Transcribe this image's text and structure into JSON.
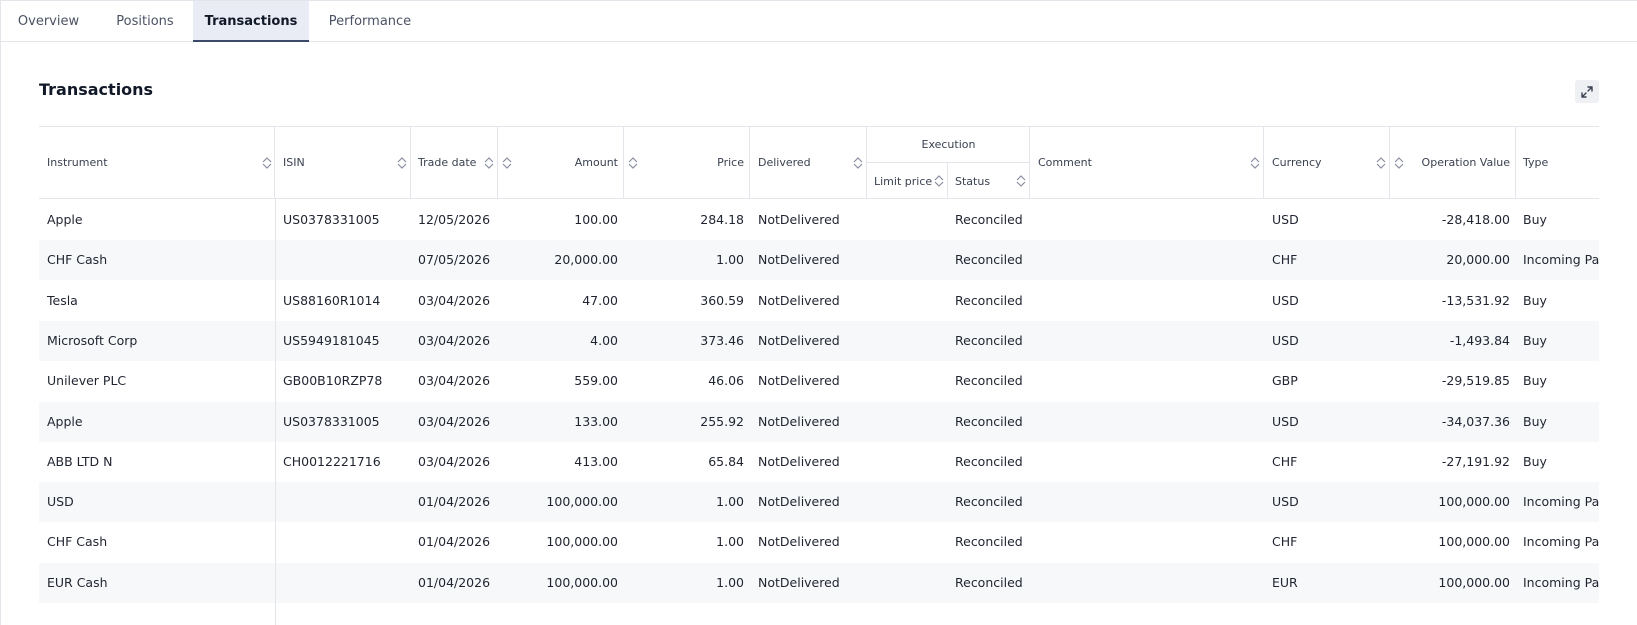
{
  "tabs": [
    {
      "label": "Overview"
    },
    {
      "label": "Positions"
    },
    {
      "label": "Transactions"
    },
    {
      "label": "Performance"
    }
  ],
  "panel": {
    "title": "Transactions"
  },
  "table": {
    "headers": {
      "instrument": "Instrument",
      "isin": "ISIN",
      "trade_date": "Trade date",
      "amount": "Amount",
      "price": "Price",
      "delivered": "Delivered",
      "execution": "Execution",
      "limit_price": "Limit price",
      "status": "Status",
      "comment": "Comment",
      "currency": "Currency",
      "operation_value": "Operation Value",
      "type": "Type"
    },
    "rows": [
      {
        "instrument": "Apple",
        "isin": "US0378331005",
        "trade_date": "12/05/2026",
        "amount": "100.00",
        "price": "284.18",
        "delivered": "NotDelivered",
        "limit_price": "",
        "status": "Reconciled",
        "comment": "",
        "currency": "USD",
        "operation_value": "-28,418.00",
        "type": "Buy"
      },
      {
        "instrument": "CHF Cash",
        "isin": "",
        "trade_date": "07/05/2026",
        "amount": "20,000.00",
        "price": "1.00",
        "delivered": "NotDelivered",
        "limit_price": "",
        "status": "Reconciled",
        "comment": "",
        "currency": "CHF",
        "operation_value": "20,000.00",
        "type": "Incoming Pay"
      },
      {
        "instrument": "Tesla",
        "isin": "US88160R1014",
        "trade_date": "03/04/2026",
        "amount": "47.00",
        "price": "360.59",
        "delivered": "NotDelivered",
        "limit_price": "",
        "status": "Reconciled",
        "comment": "",
        "currency": "USD",
        "operation_value": "-13,531.92",
        "type": "Buy"
      },
      {
        "instrument": "Microsoft Corp",
        "isin": "US5949181045",
        "trade_date": "03/04/2026",
        "amount": "4.00",
        "price": "373.46",
        "delivered": "NotDelivered",
        "limit_price": "",
        "status": "Reconciled",
        "comment": "",
        "currency": "USD",
        "operation_value": "-1,493.84",
        "type": "Buy"
      },
      {
        "instrument": "Unilever PLC",
        "isin": "GB00B10RZP78",
        "trade_date": "03/04/2026",
        "amount": "559.00",
        "price": "46.06",
        "delivered": "NotDelivered",
        "limit_price": "",
        "status": "Reconciled",
        "comment": "",
        "currency": "GBP",
        "operation_value": "-29,519.85",
        "type": "Buy"
      },
      {
        "instrument": "Apple",
        "isin": "US0378331005",
        "trade_date": "03/04/2026",
        "amount": "133.00",
        "price": "255.92",
        "delivered": "NotDelivered",
        "limit_price": "",
        "status": "Reconciled",
        "comment": "",
        "currency": "USD",
        "operation_value": "-34,037.36",
        "type": "Buy"
      },
      {
        "instrument": "ABB LTD N",
        "isin": "CH0012221716",
        "trade_date": "03/04/2026",
        "amount": "413.00",
        "price": "65.84",
        "delivered": "NotDelivered",
        "limit_price": "",
        "status": "Reconciled",
        "comment": "",
        "currency": "CHF",
        "operation_value": "-27,191.92",
        "type": "Buy"
      },
      {
        "instrument": "USD",
        "isin": "",
        "trade_date": "01/04/2026",
        "amount": "100,000.00",
        "price": "1.00",
        "delivered": "NotDelivered",
        "limit_price": "",
        "status": "Reconciled",
        "comment": "",
        "currency": "USD",
        "operation_value": "100,000.00",
        "type": "Incoming Pay"
      },
      {
        "instrument": "CHF Cash",
        "isin": "",
        "trade_date": "01/04/2026",
        "amount": "100,000.00",
        "price": "1.00",
        "delivered": "NotDelivered",
        "limit_price": "",
        "status": "Reconciled",
        "comment": "",
        "currency": "CHF",
        "operation_value": "100,000.00",
        "type": "Incoming Pay"
      },
      {
        "instrument": "EUR Cash",
        "isin": "",
        "trade_date": "01/04/2026",
        "amount": "100,000.00",
        "price": "1.00",
        "delivered": "NotDelivered",
        "limit_price": "",
        "status": "Reconciled",
        "comment": "",
        "currency": "EUR",
        "operation_value": "100,000.00",
        "type": "Incoming Pay"
      }
    ]
  },
  "icons": {
    "sort": "sort-icon",
    "expand": "expand-icon"
  }
}
